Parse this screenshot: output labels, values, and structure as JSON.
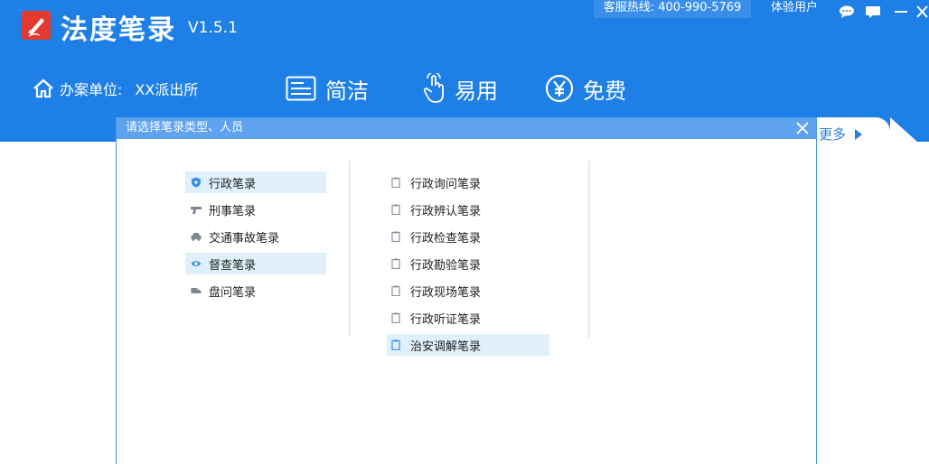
{
  "header": {
    "app_name": "法度笔录",
    "version": "V1.5.1",
    "hotline_label": "客服热线:",
    "hotline_number": "400-990-5769",
    "trial_user": "体验用户",
    "org_label": "办案单位:",
    "org_value": "XX派出所",
    "features": [
      {
        "label": "简洁",
        "icon": "document-lines-icon"
      },
      {
        "label": "易用",
        "icon": "tap-hand-icon"
      },
      {
        "label": "免费",
        "icon": "yen-circle-icon"
      }
    ],
    "more_label": "更多"
  },
  "dialog": {
    "title": "请选择笔录类型、人员",
    "record_types": [
      {
        "label": "行政笔录",
        "icon": "shield-icon",
        "highlighted": true
      },
      {
        "label": "刑事笔录",
        "icon": "gun-icon",
        "highlighted": false
      },
      {
        "label": "交通事故笔录",
        "icon": "car-icon",
        "highlighted": false
      },
      {
        "label": "督查笔录",
        "icon": "eye-icon",
        "highlighted": true
      },
      {
        "label": "盘问笔录",
        "icon": "truck-icon",
        "highlighted": false
      }
    ],
    "records": [
      {
        "label": "行政询问笔录",
        "highlighted": false
      },
      {
        "label": "行政辨认笔录",
        "highlighted": false
      },
      {
        "label": "行政检查笔录",
        "highlighted": false
      },
      {
        "label": "行政勘验笔录",
        "highlighted": false
      },
      {
        "label": "行政现场笔录",
        "highlighted": false
      },
      {
        "label": "行政听证笔录",
        "highlighted": false
      },
      {
        "label": "治安调解笔录",
        "highlighted": true
      }
    ]
  },
  "colors": {
    "header_bg": "#1e7fe6",
    "dialog_title_bg": "#5fa3ef",
    "highlight_bg": "#dff0fb",
    "logo_red": "#e23a2e",
    "link_blue": "#2a7fdc"
  }
}
